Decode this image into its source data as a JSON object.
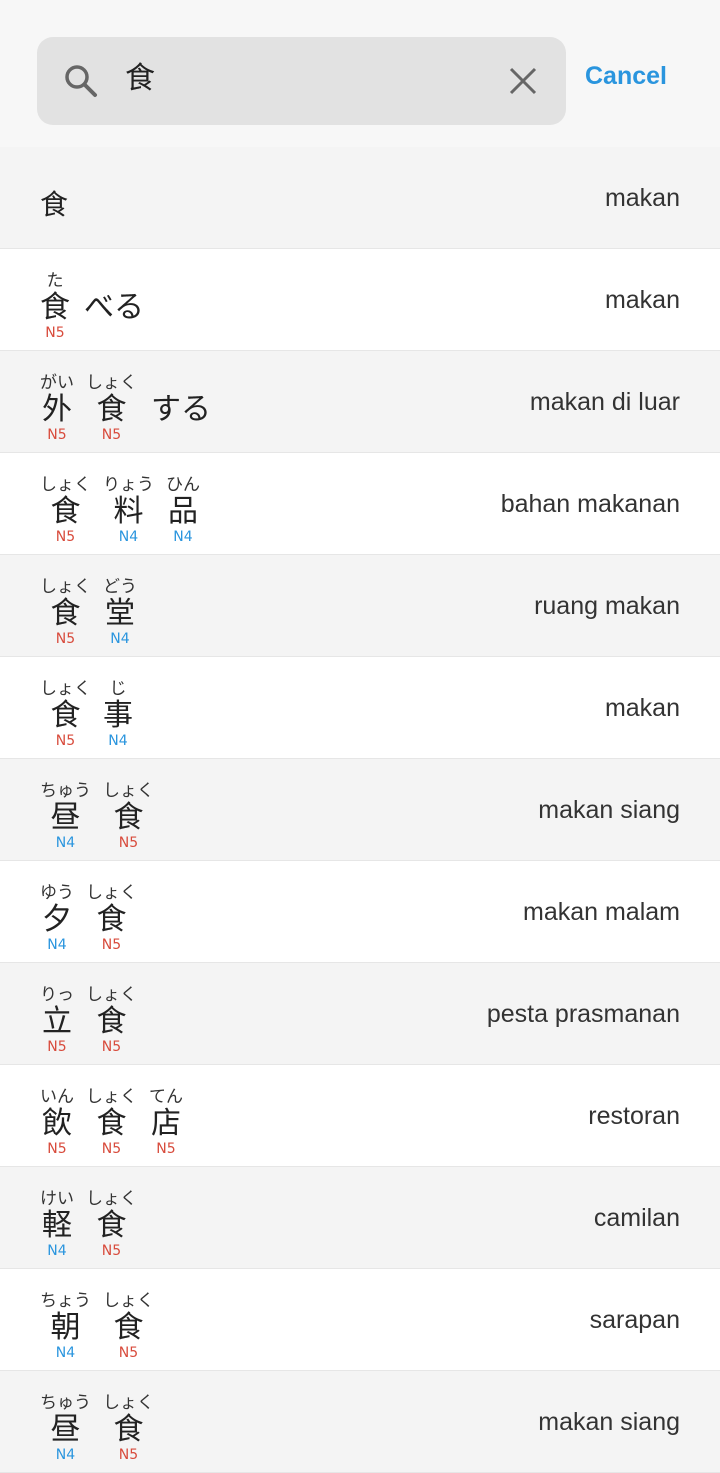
{
  "search": {
    "query": "食",
    "cancel_label": "Cancel"
  },
  "results": [
    {
      "plain_headword": "食",
      "meaning": "makan",
      "units": [],
      "suffix": ""
    },
    {
      "meaning": "makan",
      "units": [
        {
          "reading": "た",
          "kanji": "食",
          "level": "N5"
        }
      ],
      "suffix": "べる"
    },
    {
      "meaning": "makan di luar",
      "units": [
        {
          "reading": "がい",
          "kanji": "外",
          "level": "N5"
        },
        {
          "reading": "しょく",
          "kanji": "食",
          "level": "N5"
        }
      ],
      "suffix": "する"
    },
    {
      "meaning": "bahan makanan",
      "units": [
        {
          "reading": "しょく",
          "kanji": "食",
          "level": "N5"
        },
        {
          "reading": "りょう",
          "kanji": "料",
          "level": "N4"
        },
        {
          "reading": "ひん",
          "kanji": "品",
          "level": "N4"
        }
      ],
      "suffix": ""
    },
    {
      "meaning": "ruang makan",
      "units": [
        {
          "reading": "しょく",
          "kanji": "食",
          "level": "N5"
        },
        {
          "reading": "どう",
          "kanji": "堂",
          "level": "N4"
        }
      ],
      "suffix": ""
    },
    {
      "meaning": "makan",
      "units": [
        {
          "reading": "しょく",
          "kanji": "食",
          "level": "N5"
        },
        {
          "reading": "じ",
          "kanji": "事",
          "level": "N4"
        }
      ],
      "suffix": ""
    },
    {
      "meaning": "makan siang",
      "units": [
        {
          "reading": "ちゅう",
          "kanji": "昼",
          "level": "N4"
        },
        {
          "reading": "しょく",
          "kanji": "食",
          "level": "N5"
        }
      ],
      "suffix": ""
    },
    {
      "meaning": "makan malam",
      "units": [
        {
          "reading": "ゆう",
          "kanji": "夕",
          "level": "N4"
        },
        {
          "reading": "しょく",
          "kanji": "食",
          "level": "N5"
        }
      ],
      "suffix": ""
    },
    {
      "meaning": "pesta prasmanan",
      "units": [
        {
          "reading": "りっ",
          "kanji": "立",
          "level": "N5"
        },
        {
          "reading": "しょく",
          "kanji": "食",
          "level": "N5"
        }
      ],
      "suffix": ""
    },
    {
      "meaning": "restoran",
      "units": [
        {
          "reading": "いん",
          "kanji": "飲",
          "level": "N5"
        },
        {
          "reading": "しょく",
          "kanji": "食",
          "level": "N5"
        },
        {
          "reading": "てん",
          "kanji": "店",
          "level": "N5"
        }
      ],
      "suffix": ""
    },
    {
      "meaning": "camilan",
      "units": [
        {
          "reading": "けい",
          "kanji": "軽",
          "level": "N4"
        },
        {
          "reading": "しょく",
          "kanji": "食",
          "level": "N5"
        }
      ],
      "suffix": ""
    },
    {
      "meaning": "sarapan",
      "units": [
        {
          "reading": "ちょう",
          "kanji": "朝",
          "level": "N4"
        },
        {
          "reading": "しょく",
          "kanji": "食",
          "level": "N5"
        }
      ],
      "suffix": ""
    },
    {
      "meaning": "makan siang",
      "units": [
        {
          "reading": "ちゅう",
          "kanji": "昼",
          "level": "N4"
        },
        {
          "reading": "しょく",
          "kanji": "食",
          "level": "N5"
        }
      ],
      "suffix": ""
    }
  ],
  "colors": {
    "accent": "#2a95de",
    "n5": "#d84b3c",
    "n4": "#2a95de"
  },
  "icons": {
    "search": "search-icon",
    "clear": "close-icon"
  }
}
